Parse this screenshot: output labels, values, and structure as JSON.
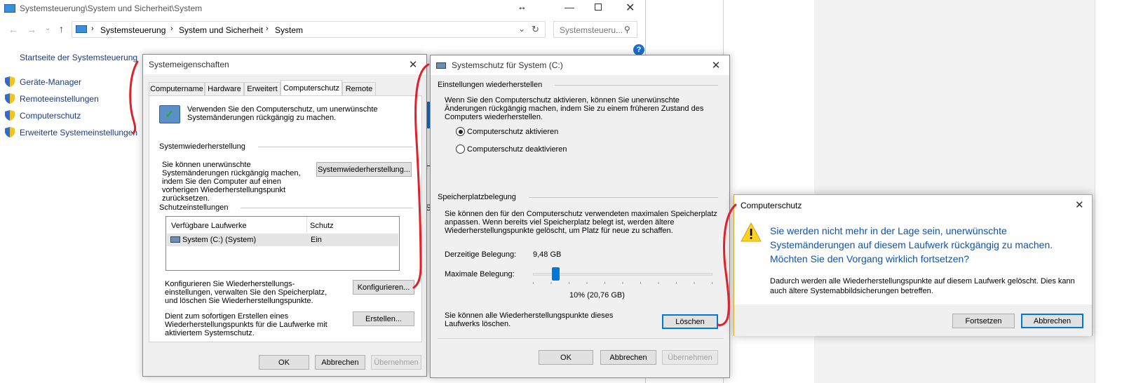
{
  "explorer": {
    "title": "Systemsteuerung\\System und Sicherheit\\System",
    "breadcrumb": [
      "Systemsteuerung",
      "System und Sicherheit",
      "System"
    ],
    "search_placeholder": "Systemsteueru...",
    "home_link": "Startseite der Systemsteuerung",
    "side_links": [
      "Geräte-Manager",
      "Remoteeinstellungen",
      "Computerschutz",
      "Erweiterte Systemeinstellungen"
    ],
    "help": "?",
    "frag_h": "H",
    "frag_s": "S"
  },
  "sysprops": {
    "title": "Systemeigenschaften",
    "tabs": [
      "Computername",
      "Hardware",
      "Erweitert",
      "Computerschutz",
      "Remote"
    ],
    "intro": "Verwenden Sie den Computerschutz, um unerwünschte Systemänderungen rückgängig zu machen.",
    "restore_group": "Systemwiederherstellung",
    "restore_text": "Sie können unerwünschte Systemänderungen rückgängig machen, indem Sie den Computer auf einen vorherigen Wiederherstellungspunkt zurücksetzen.",
    "restore_button": "Systemwiederherstellung...",
    "protect_group": "Schutzeinstellungen",
    "col_drives": "Verfügbare Laufwerke",
    "col_protect": "Schutz",
    "drive_name": "System (C:) (System)",
    "drive_status": "Ein",
    "config_text": "Konfigurieren Sie Wiederherstellungs-einstellungen, verwalten Sie den Speicherplatz, und löschen Sie Wiederherstellungspunkte.",
    "config_button": "Konfigurieren...",
    "create_text": "Dient zum sofortigen Erstellen eines Wiederherstellungspunkts für die Laufwerke mit aktiviertem Systemschutz.",
    "create_button": "Erstellen...",
    "ok": "OK",
    "cancel": "Abbrechen",
    "apply": "Übernehmen"
  },
  "sysprot": {
    "title": "Systemschutz für System (C:)",
    "restore_group": "Einstellungen wiederherstellen",
    "restore_text": "Wenn Sie den Computerschutz aktivieren, können Sie unerwünschte Änderungen rückgängig machen, indem Sie zu einem früheren Zustand des Computers wiederherstellen.",
    "radio_on": "Computerschutz aktivieren",
    "radio_off": "Computerschutz deaktivieren",
    "disk_group": "Speicherplatzbelegung",
    "disk_text": "Sie können den für den Computerschutz verwendeten maximalen Speicherplatz anpassen. Wenn bereits viel Speicherplatz belegt ist, werden ältere Wiederherstellungspunkte gelöscht, um Platz für neue zu schaffen.",
    "current_label": "Derzeitige Belegung:",
    "current_value": "9,48 GB",
    "max_label": "Maximale Belegung:",
    "max_fraction": 0.1,
    "max_value": "10% (20,76 GB)",
    "delete_text": "Sie können alle Wiederherstellungspunkte dieses Laufwerks löschen.",
    "delete_button": "Löschen",
    "ok": "OK",
    "cancel": "Abbrechen",
    "apply": "Übernehmen"
  },
  "confirm": {
    "title": "Computerschutz",
    "headline": "Sie werden nicht mehr in der Lage sein, unerwünschte Systemänderungen auf diesem Laufwerk rückgängig zu machen. Möchten Sie den Vorgang wirklich fortsetzen?",
    "detail": "Dadurch werden alle Wiederherstellungspunkte auf diesem Laufwerk gelöscht. Dies kann auch ältere Systemabbildsicherungen betreffen.",
    "continue": "Fortsetzen",
    "cancel": "Abbrechen"
  },
  "colors": {
    "accent": "#0078d7",
    "link": "#1a3b82",
    "headline": "#0a54b5",
    "annotation": "#e0202a"
  }
}
